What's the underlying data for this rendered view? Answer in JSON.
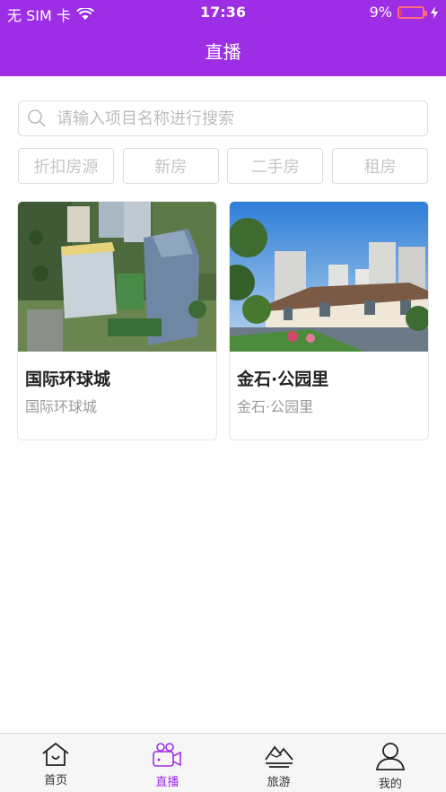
{
  "status": {
    "carrier": "无 SIM 卡",
    "time": "17:36",
    "battery": "9%",
    "battery_level": 0.09
  },
  "header": {
    "title": "直播"
  },
  "search": {
    "placeholder": "请输入项目名称进行搜索"
  },
  "filters": [
    "折扣房源",
    "新房",
    "二手房",
    "租房"
  ],
  "cards": [
    {
      "title": "国际环球城",
      "subtitle": "国际环球城"
    },
    {
      "title": "金石·公园里",
      "subtitle": "金石·公园里"
    }
  ],
  "tabs": [
    {
      "label": "首页",
      "icon": "home-icon"
    },
    {
      "label": "直播",
      "icon": "video-camera-icon"
    },
    {
      "label": "旅游",
      "icon": "mountain-icon"
    },
    {
      "label": "我的",
      "icon": "person-icon"
    }
  ],
  "colors": {
    "accent": "#9e2ee6",
    "battery_low": "#ff3b4f"
  }
}
